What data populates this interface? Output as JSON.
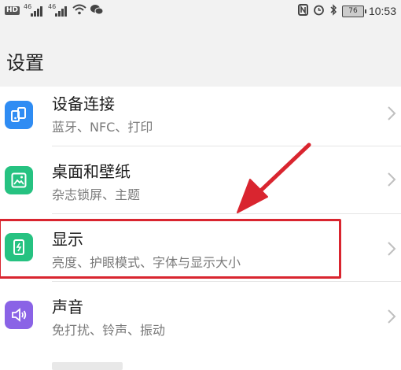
{
  "status_bar": {
    "hd": "HD",
    "net1": "46",
    "net2": "46",
    "battery": "76",
    "time": "10:53",
    "icons": [
      "wifi-icon",
      "wechat-icon",
      "nfc-icon",
      "alarm-icon",
      "bluetooth-icon",
      "battery-icon"
    ]
  },
  "header": {
    "title": "设置"
  },
  "items": [
    {
      "title": "设备连接",
      "subtitle": "蓝牙、NFC、打印",
      "icon": "device-connection-icon",
      "color": "#2f8cf3"
    },
    {
      "title": "桌面和壁纸",
      "subtitle": "杂志锁屏、主题",
      "icon": "wallpaper-icon",
      "color": "#26c281"
    },
    {
      "title": "显示",
      "subtitle": "亮度、护眼模式、字体与显示大小",
      "icon": "display-icon",
      "color": "#26c281"
    },
    {
      "title": "声音",
      "subtitle": "免打扰、铃声、振动",
      "icon": "sound-icon",
      "color": "#8a63e6"
    }
  ],
  "annotation": {
    "highlight_color": "#d9252f",
    "highlighted_item": "显示"
  }
}
